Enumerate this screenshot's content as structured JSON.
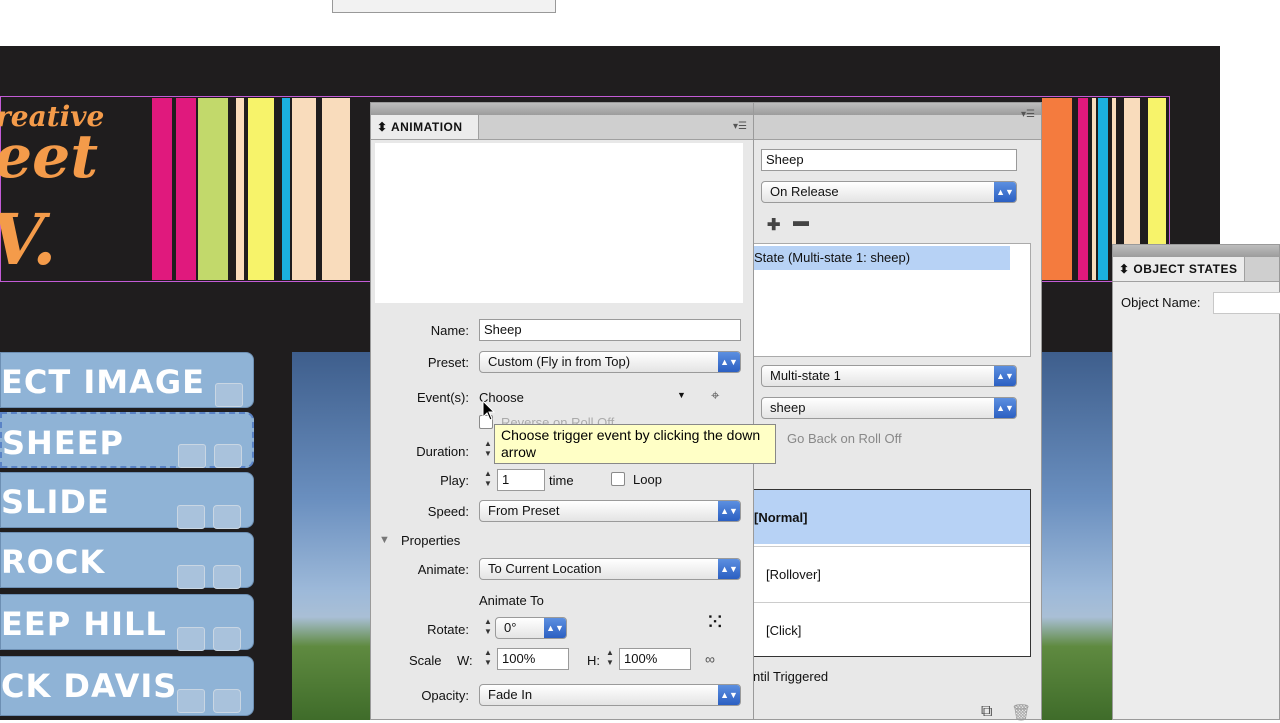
{
  "canvas": {
    "background": "#1f1d1e",
    "stripe_colors": [
      "#e0197d",
      "#c2d96b",
      "#f7f36a",
      "#1bb0e0",
      "#f9dcbc",
      "#f47b3e"
    ]
  },
  "logo": {
    "line1": "reative",
    "line2": "eet",
    "line3": "V.",
    "color": "#f49b4a"
  },
  "buttons": [
    {
      "label": "ECT IMAGE"
    },
    {
      "label": "SHEEP"
    },
    {
      "label": "SLIDE"
    },
    {
      "label": "ROCK"
    },
    {
      "label": "EEP HILL"
    },
    {
      "label": "CK DAVIS"
    }
  ],
  "animation_panel": {
    "tab_label": "ANIMATION",
    "name_label": "Name:",
    "name_value": "Sheep",
    "preset_label": "Preset:",
    "preset_value": "Custom (Fly in from Top)",
    "events_label": "Event(s):",
    "events_value": "Choose",
    "reverse_label": "Reverse on Roll Off",
    "tooltip": "Choose trigger event by clicking the down arrow",
    "duration_label": "Duration:",
    "play_label": "Play:",
    "play_value": "1",
    "time_label": "time",
    "loop_label": "Loop",
    "speed_label": "Speed:",
    "speed_value": "From Preset",
    "properties_label": "Properties",
    "animate_label": "Animate:",
    "animate_value": "To Current Location",
    "animate_to_label": "Animate To",
    "rotate_label": "Rotate:",
    "rotate_value": "0°",
    "scale_label": "Scale",
    "w_label": "W:",
    "w_value": "100%",
    "h_label": "H:",
    "h_value": "100%",
    "opacity_label": "Opacity:",
    "opacity_value": "Fade In"
  },
  "buttons_panel": {
    "name_value": "Sheep",
    "event_value": "On Release",
    "action_item": "State (Multi-state 1: sheep)",
    "object_value": "Multi-state 1",
    "state_value": "sheep",
    "go_back_label": "Go Back on Roll Off",
    "appearance": [
      "[Normal]",
      "[Rollover]",
      "[Click]"
    ],
    "hidden_label": "ntil Triggered"
  },
  "object_states_panel": {
    "tab_label": "OBJECT STATES",
    "name_label": "Object Name:"
  }
}
